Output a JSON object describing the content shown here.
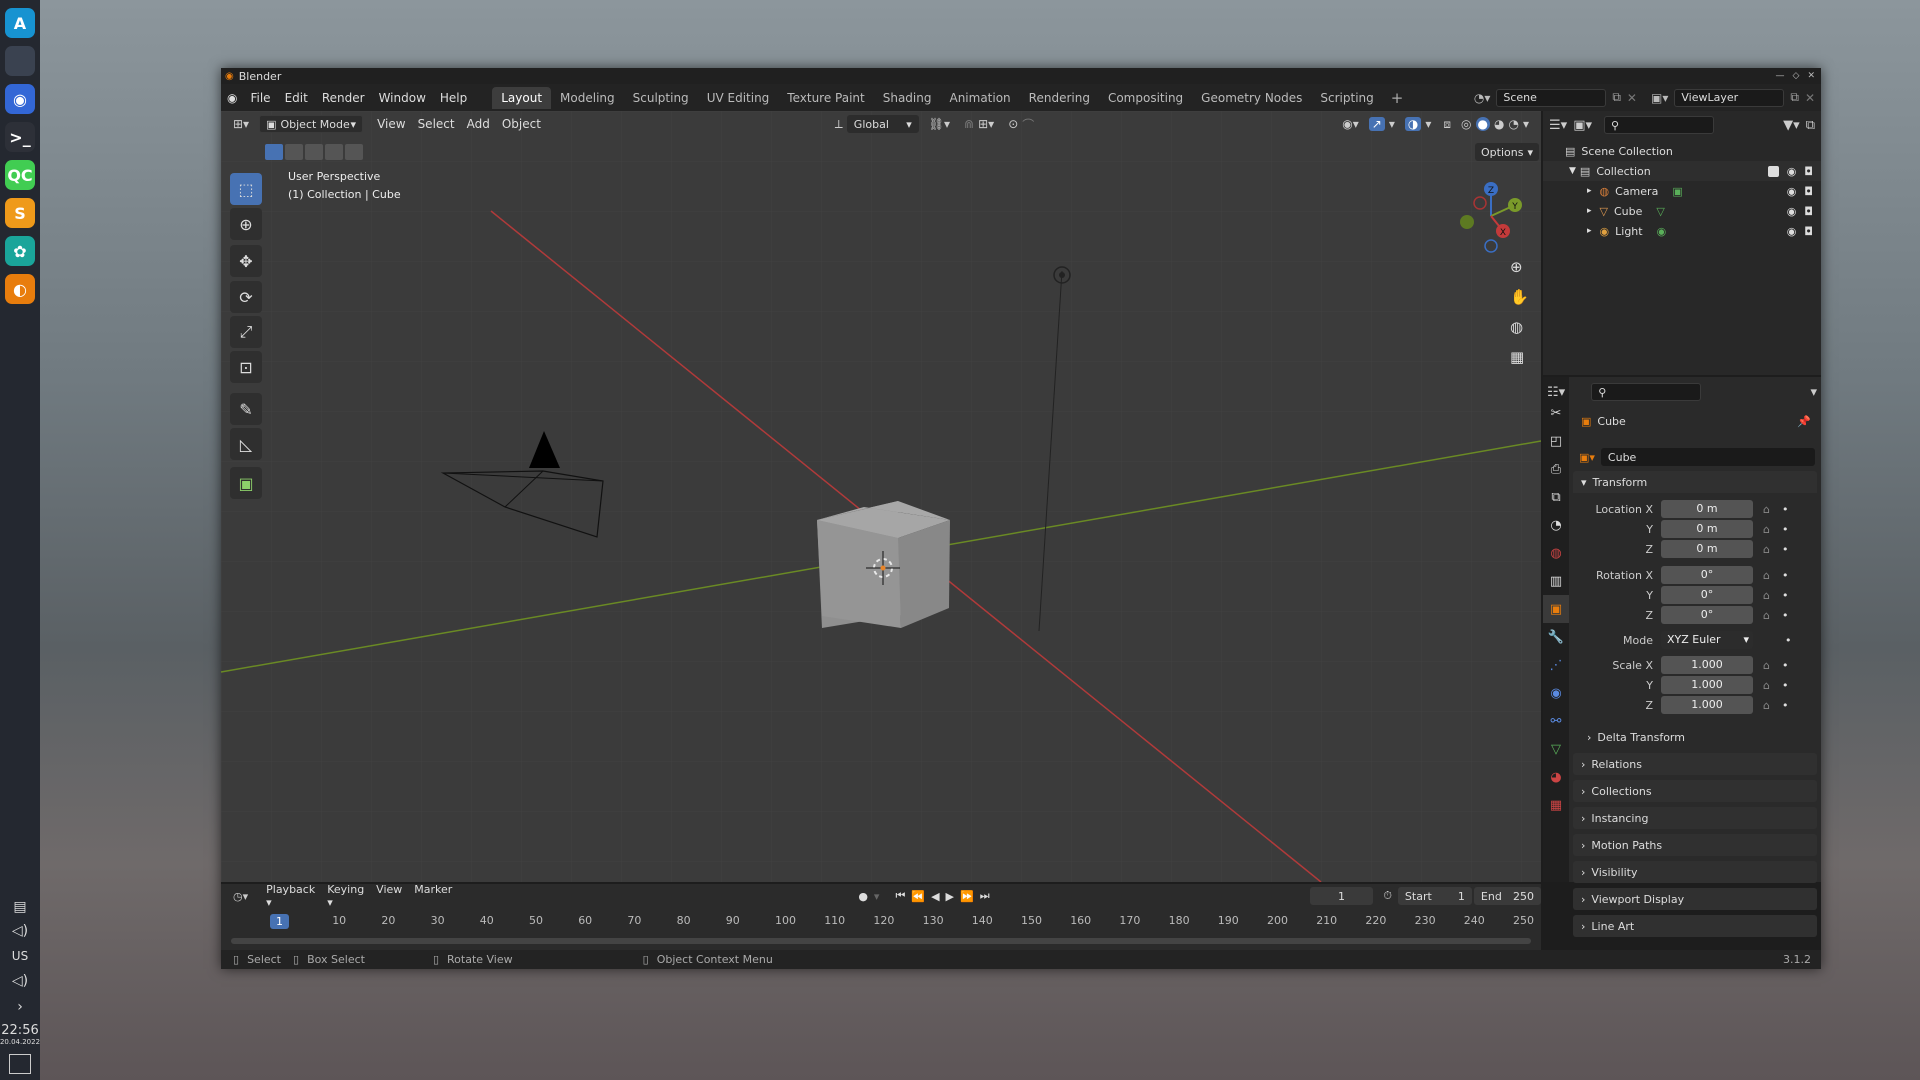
{
  "dock": {
    "clock_time": "22:56",
    "clock_date": "20.04.2022",
    "keyboard_layout": "US",
    "apps": [
      {
        "icon": "arch-linux-icon",
        "glyph": "A",
        "color": "#1793d1"
      },
      {
        "icon": "files-icon",
        "glyph": "",
        "color": "#3a4250"
      },
      {
        "icon": "chromium-icon",
        "glyph": "◉",
        "color": "#3367d6"
      },
      {
        "icon": "terminal-icon",
        "glyph": ">_",
        "color": "#2d3038"
      },
      {
        "icon": "qtcreator-icon",
        "glyph": "QC",
        "color": "#41cd52"
      },
      {
        "icon": "sublime-text-icon",
        "glyph": "S",
        "color": "#ef9a1a"
      },
      {
        "icon": "krita-icon",
        "glyph": "✿",
        "color": "#1aa59a"
      },
      {
        "icon": "blender-dock-icon",
        "glyph": "◐",
        "color": "#e87d0d"
      }
    ]
  },
  "window": {
    "title": "Blender",
    "menu": [
      "File",
      "Edit",
      "Render",
      "Window",
      "Help"
    ],
    "workspaces": [
      "Layout",
      "Modeling",
      "Sculpting",
      "UV Editing",
      "Texture Paint",
      "Shading",
      "Animation",
      "Rendering",
      "Compositing",
      "Geometry Nodes",
      "Scripting"
    ],
    "active_workspace": "Layout",
    "add_workspace": "+",
    "scene": "Scene",
    "view_layer": "ViewLayer"
  },
  "viewport": {
    "mode": "Object Mode",
    "menus": [
      "View",
      "Select",
      "Add",
      "Object"
    ],
    "orientation": "Global",
    "options": "Options",
    "perspective_label": "User Perspective",
    "context_label": "(1) Collection | Cube",
    "gizmo": {
      "x": "X",
      "y": "Y",
      "z": "Z"
    }
  },
  "outliner": {
    "root": "Scene Collection",
    "collection": "Collection",
    "items": [
      {
        "name": "Camera",
        "icon": "camera-icon",
        "color": "#d97f3a"
      },
      {
        "name": "Cube",
        "icon": "mesh-icon",
        "color": "#e09a52"
      },
      {
        "name": "Light",
        "icon": "light-icon",
        "color": "#e0a040"
      }
    ]
  },
  "properties": {
    "object_name": "Cube",
    "datablock_name": "Cube",
    "transform_label": "Transform",
    "location": {
      "label": "Location X",
      "x": "0 m",
      "y": "0 m",
      "z": "0 m"
    },
    "rotation": {
      "label": "Rotation X",
      "x": "0°",
      "y": "0°",
      "z": "0°"
    },
    "axis_y": "Y",
    "axis_z": "Z",
    "mode_label": "Mode",
    "mode_value": "XYZ Euler",
    "scale": {
      "label": "Scale X",
      "x": "1.000",
      "y": "1.000",
      "z": "1.000"
    },
    "delta_transform": "Delta Transform",
    "panels": [
      "Relations",
      "Collections",
      "Instancing",
      "Motion Paths",
      "Visibility",
      "Viewport Display",
      "Line Art"
    ]
  },
  "timeline": {
    "menus": [
      "Playback",
      "Keying",
      "View",
      "Marker"
    ],
    "current_frame": "1",
    "start_label": "Start",
    "start_value": "1",
    "end_label": "End",
    "end_value": "250",
    "ruler": [
      "1",
      "10",
      "20",
      "30",
      "40",
      "50",
      "60",
      "70",
      "80",
      "90",
      "100",
      "110",
      "120",
      "130",
      "140",
      "150",
      "160",
      "170",
      "180",
      "190",
      "200",
      "210",
      "220",
      "230",
      "240",
      "250"
    ]
  },
  "statusbar": {
    "select": "Select",
    "box_select": "Box Select",
    "rotate_view": "Rotate View",
    "context_menu": "Object Context Menu",
    "version": "3.1.2"
  },
  "colors": {
    "accent": "#4772b3",
    "x_axis": "#c33a3a",
    "y_axis": "#7a9a2a",
    "z_axis": "#3a6ec3"
  }
}
